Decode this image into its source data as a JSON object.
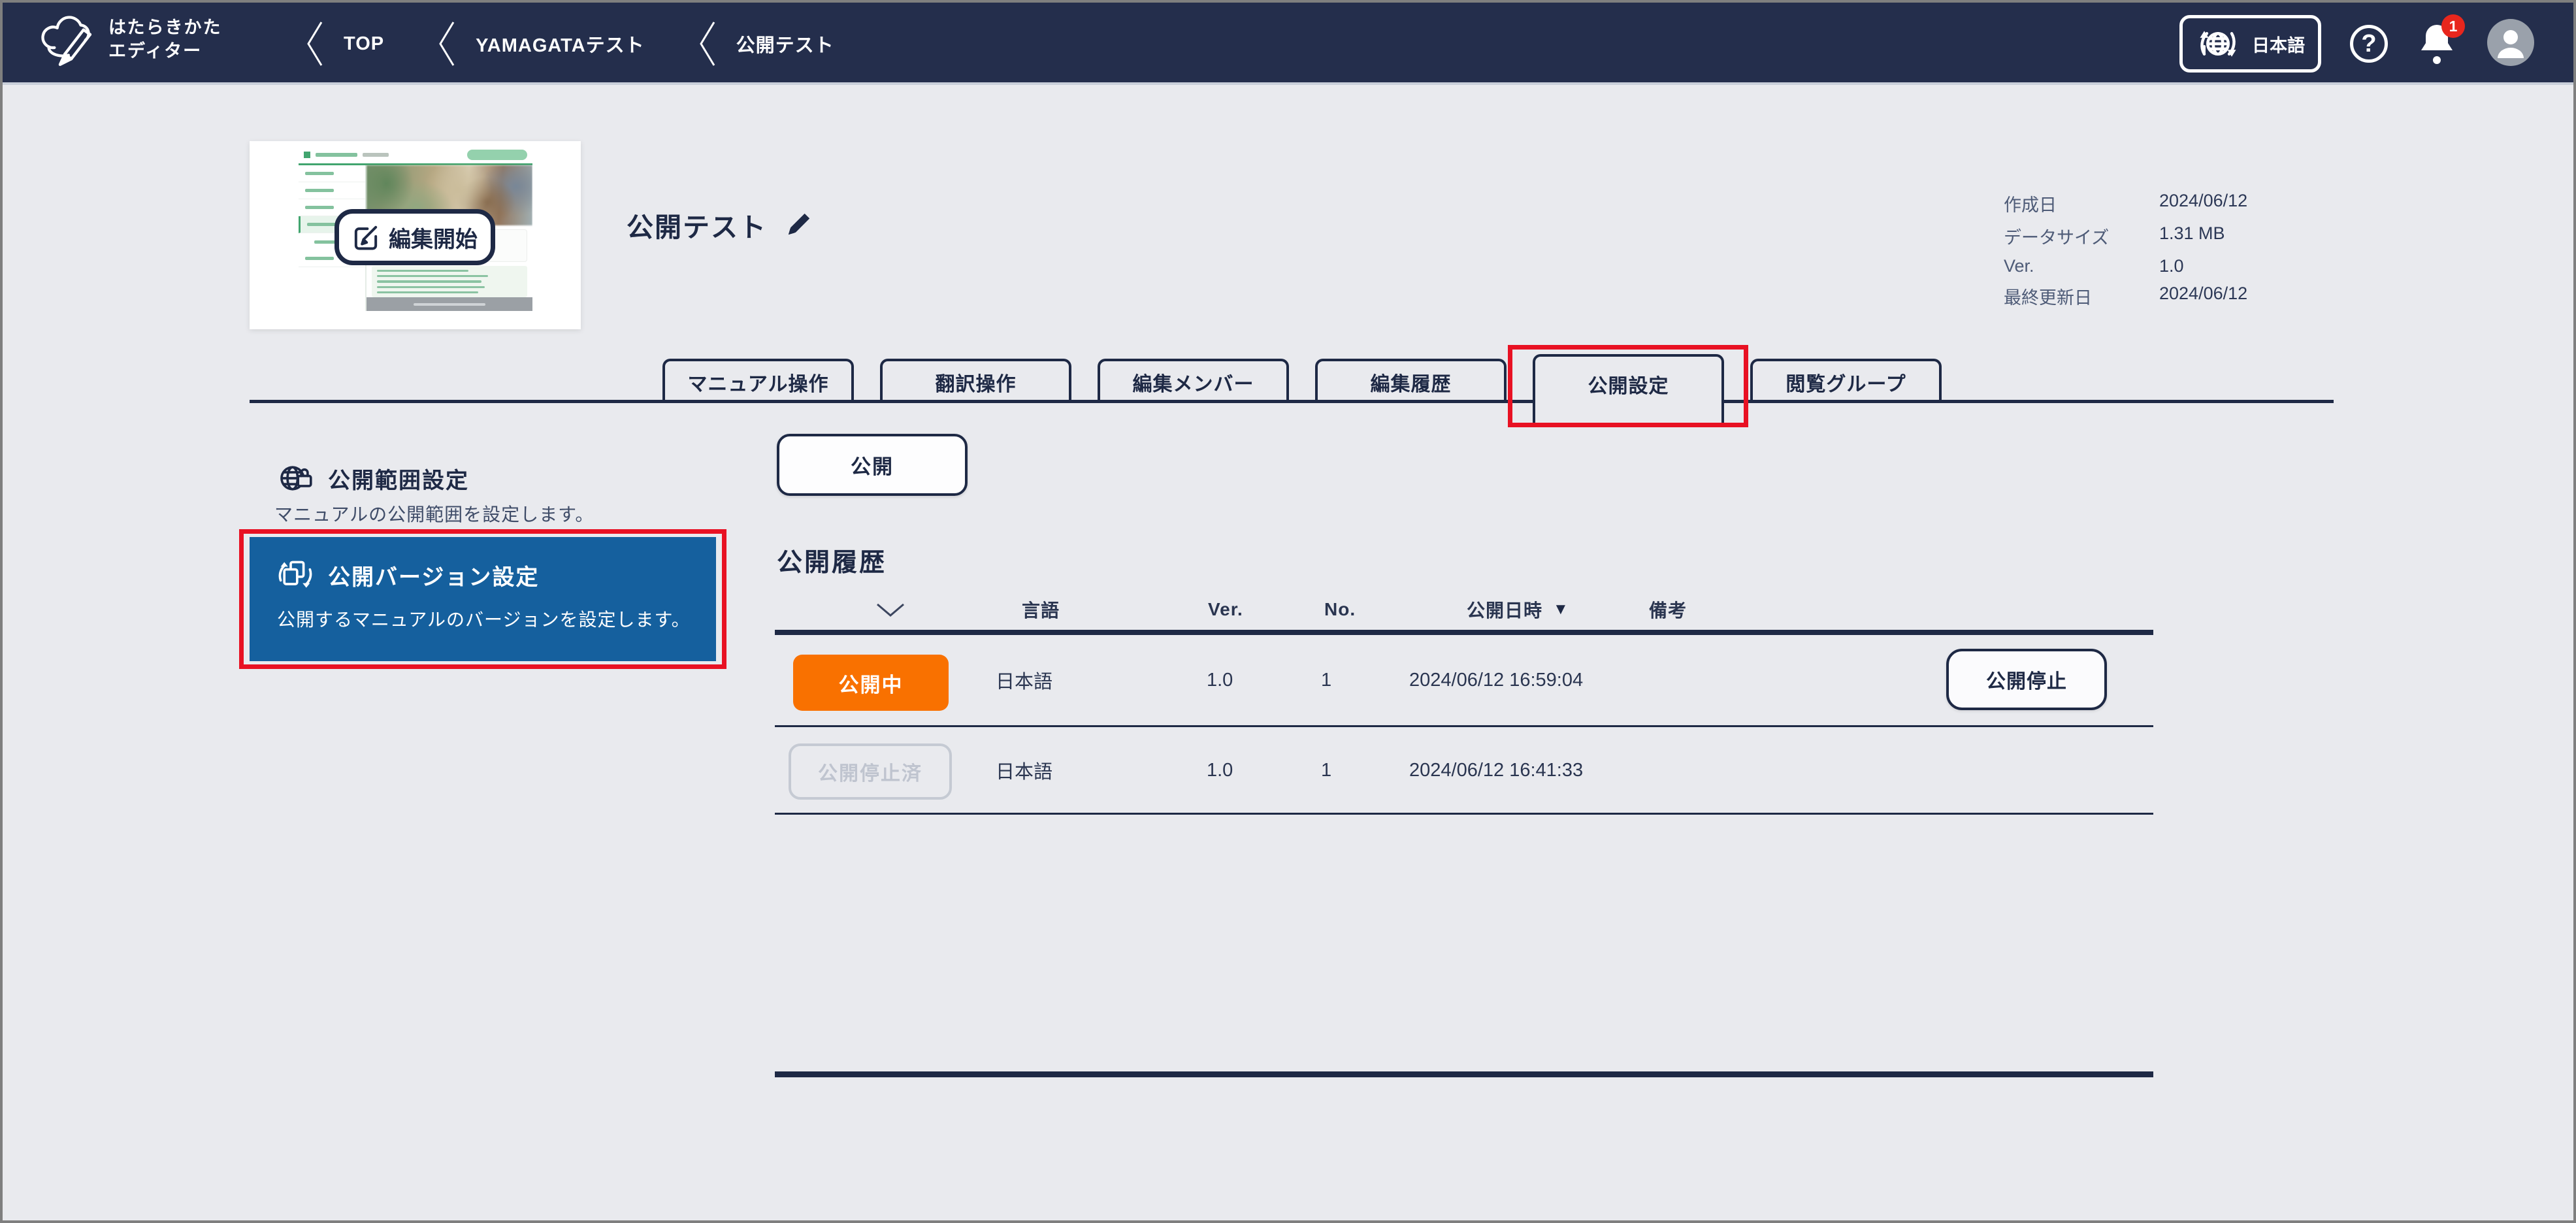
{
  "topbar": {
    "logo_line1": "はたらきかた",
    "logo_line2": "エディター",
    "breadcrumbs": [
      "TOP",
      "YAMAGATAテスト",
      "公開テスト"
    ],
    "language_label": "日本語",
    "notification_count": "1",
    "help_glyph": "?"
  },
  "document": {
    "title": "公開テスト",
    "edit_start_label": "編集開始",
    "meta": [
      {
        "label": "作成日",
        "value": "2024/06/12"
      },
      {
        "label": "データサイズ",
        "value": "1.31 MB"
      },
      {
        "label": "Ver.",
        "value": "1.0"
      },
      {
        "label": "最終更新日",
        "value": "2024/06/12"
      }
    ]
  },
  "tabs": [
    {
      "label": "マニュアル操作",
      "active": false
    },
    {
      "label": "翻訳操作",
      "active": false
    },
    {
      "label": "編集メンバー",
      "active": false
    },
    {
      "label": "編集履歴",
      "active": false
    },
    {
      "label": "公開設定",
      "active": true
    },
    {
      "label": "閲覧グループ",
      "active": false
    }
  ],
  "sidebar": {
    "items": [
      {
        "title": "公開範囲設定",
        "description": "マニュアルの公開範囲を設定します。",
        "selected": false
      },
      {
        "title": "公開バージョン設定",
        "description": "公開するマニュアルのバージョンを設定します。",
        "selected": true
      }
    ]
  },
  "main": {
    "publish_button_label": "公開",
    "history_title": "公開履歴",
    "table": {
      "headers": {
        "language": "言語",
        "version": "Ver.",
        "number": "No.",
        "published_at": "公開日時",
        "note": "備考"
      },
      "sort_indicator": "▼",
      "rows": [
        {
          "status": "公開中",
          "language": "日本語",
          "version": "1.0",
          "number": "1",
          "published_at": "2024/06/12 16:59:04",
          "note": "",
          "action_label": "公開停止"
        },
        {
          "status": "公開停止済",
          "language": "日本語",
          "version": "1.0",
          "number": "1",
          "published_at": "2024/06/12 16:41:33",
          "note": "",
          "action_label": ""
        }
      ]
    }
  },
  "colors": {
    "topbar_bg": "#242e4c",
    "navy": "#1e2945",
    "selected_blue": "#15609e",
    "status_orange": "#f97100",
    "inactive_gray": "#c5cad3",
    "annotation_red": "#e81123",
    "page_bg": "#e9eaee"
  }
}
